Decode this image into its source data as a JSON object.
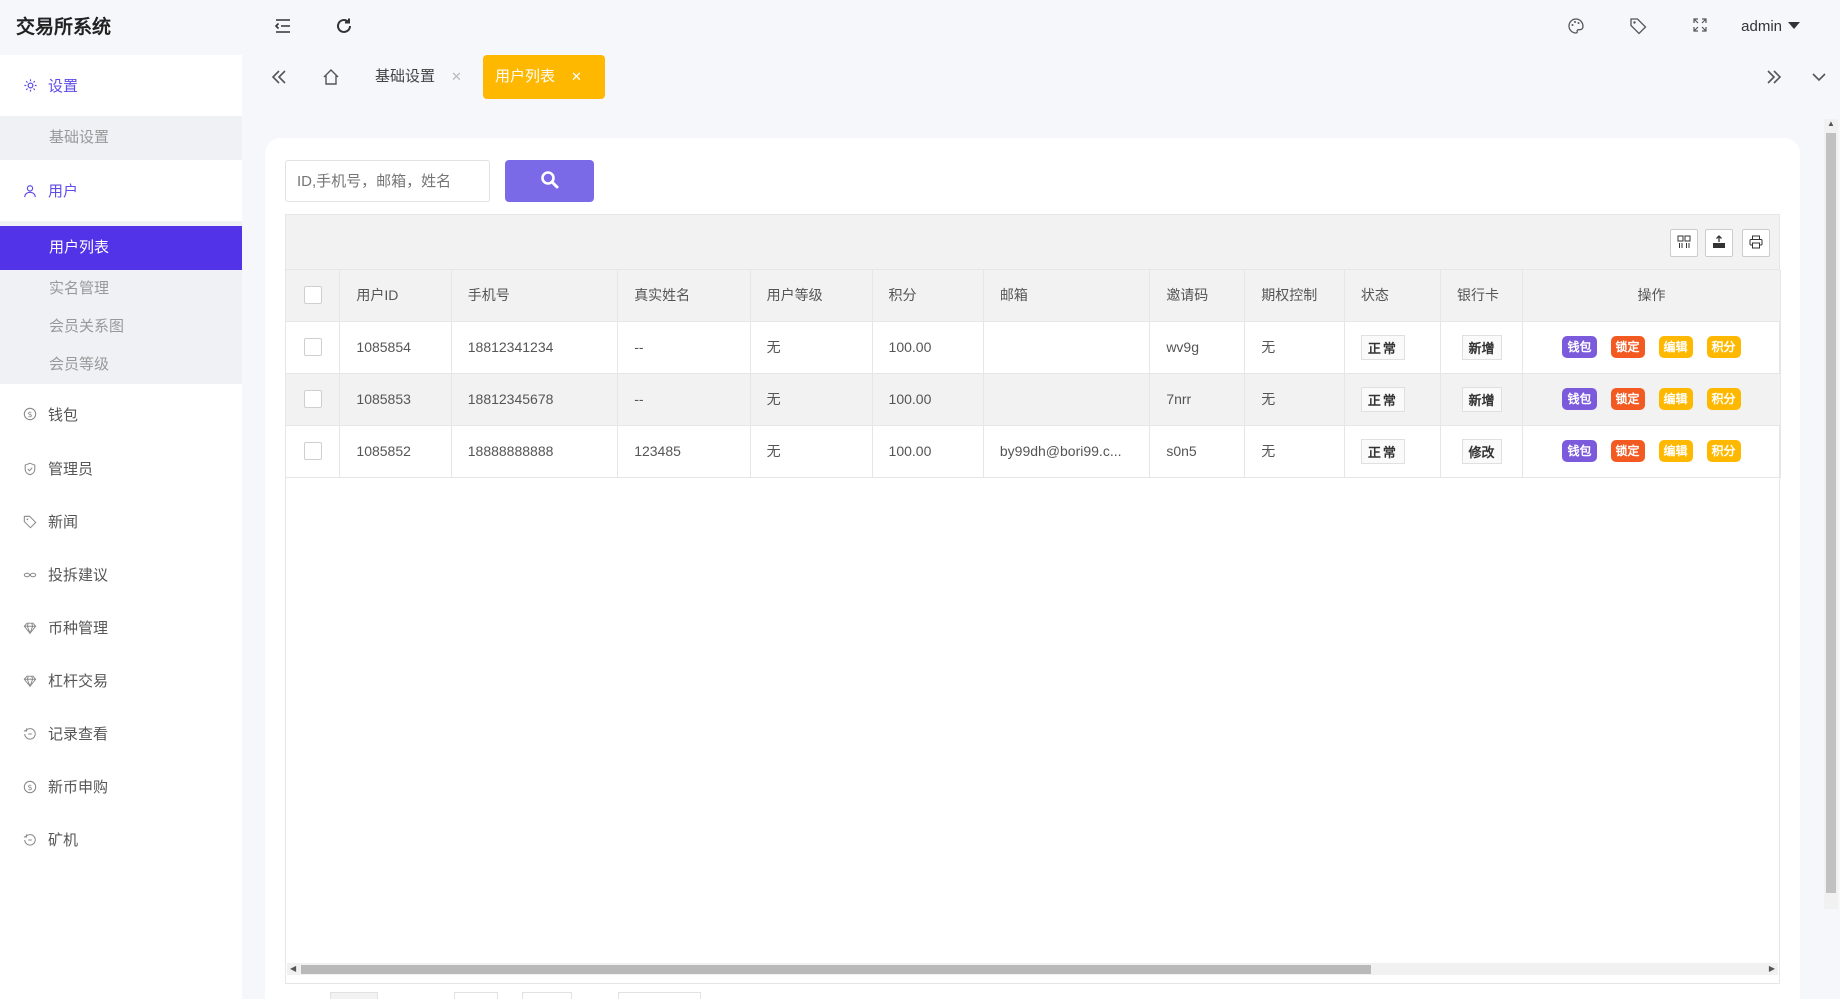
{
  "app": {
    "title": "交易所系统"
  },
  "sidebar": {
    "groups": [
      {
        "label": "设置",
        "icon": "gear-icon",
        "open": true,
        "children": [
          {
            "label": "基础设置",
            "active": false
          }
        ]
      },
      {
        "label": "用户",
        "icon": "user-icon",
        "open": true,
        "children": [
          {
            "label": "用户列表",
            "active": true
          },
          {
            "label": "实名管理",
            "active": false
          },
          {
            "label": "会员关系图",
            "active": false
          },
          {
            "label": "会员等级",
            "active": false
          }
        ]
      },
      {
        "label": "钱包",
        "icon": "dollar-icon"
      },
      {
        "label": "管理员",
        "icon": "shield-icon"
      },
      {
        "label": "新闻",
        "icon": "tag-icon"
      },
      {
        "label": "投拆建议",
        "icon": "link-icon"
      },
      {
        "label": "币种管理",
        "icon": "diamond-icon"
      },
      {
        "label": "杠杆交易",
        "icon": "diamond-icon"
      },
      {
        "label": "记录查看",
        "icon": "history-icon"
      },
      {
        "label": "新币申购",
        "icon": "dollar-icon"
      },
      {
        "label": "矿机",
        "icon": "history-icon"
      }
    ]
  },
  "topbar": {
    "user": "admin"
  },
  "tabs": [
    {
      "label": "基础设置",
      "active": false
    },
    {
      "label": "用户列表",
      "active": true
    }
  ],
  "search": {
    "placeholder": "ID,手机号，邮箱，姓名"
  },
  "table": {
    "columns": [
      "用户ID",
      "手机号",
      "真实姓名",
      "用户等级",
      "积分",
      "邮箱",
      "邀请码",
      "期权控制",
      "状态",
      "银行卡",
      "操作"
    ],
    "rows": [
      {
        "id": "1085854",
        "phone": "18812341234",
        "name": "--",
        "level": "无",
        "points": "100.00",
        "email": "",
        "invite": "wv9g",
        "option": "无",
        "status": "正常",
        "bank": "新增"
      },
      {
        "id": "1085853",
        "phone": "18812345678",
        "name": "--",
        "level": "无",
        "points": "100.00",
        "email": "",
        "invite": "7nrr",
        "option": "无",
        "status": "正常",
        "bank": "新增"
      },
      {
        "id": "1085852",
        "phone": "18888888888",
        "name": "123485",
        "level": "无",
        "points": "100.00",
        "email": "by99dh@bori99.c...",
        "invite": "s0n5",
        "option": "无",
        "status": "正常",
        "bank": "修改"
      }
    ],
    "actions": [
      "钱包",
      "锁定",
      "编辑",
      "积分"
    ]
  },
  "colors": {
    "accent": "#5233e8",
    "tab_active": "#ffb800",
    "search_btn": "#7b6ae8",
    "wallet": "#7b5bdc",
    "lock": "#f25a22",
    "edit": "#ffb800"
  }
}
